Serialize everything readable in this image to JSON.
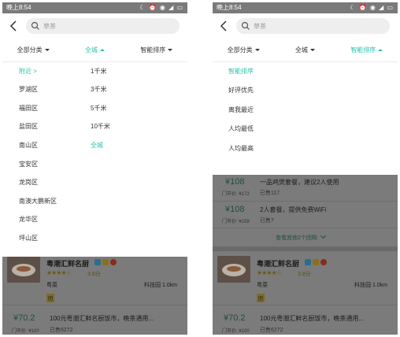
{
  "left": {
    "status": {
      "time": "晚上8:54",
      "icons": "☾ ⏰ ◉ ◢ ▭"
    },
    "search": {
      "placeholder": "草茶"
    },
    "filters": [
      "全部分类",
      "全城",
      "智能排序"
    ],
    "districts": [
      "附近",
      "罗湖区",
      "福田区",
      "盐田区",
      "南山区",
      "宝安区",
      "龙岗区",
      "南澳大鹏新区",
      "龙华区",
      "坪山区"
    ],
    "distances": [
      "1千米",
      "3千米",
      "5千米",
      "10千米",
      "全城"
    ],
    "restaurant": {
      "name": "粤潮汇鲜名厨",
      "rating": "3.8分",
      "category": "粤菜",
      "location": "科技园 1.0km",
      "tag": "团"
    },
    "deal": {
      "price": "¥70.2",
      "title": "100元粤潮汇鲜名厨饭市，晚茶通用...",
      "original": "门市价: ¥100",
      "sold": "已售6272"
    }
  },
  "right": {
    "status": {
      "time": "晚上8:54",
      "icons": "☾ ⏰ ◉ ◢ ▭"
    },
    "search": {
      "placeholder": "草茶"
    },
    "filters": [
      "全部分类",
      "全城",
      "智能排序"
    ],
    "sort_options": [
      "智能排序",
      "好评优先",
      "离我最近",
      "人均最低",
      "人均最高"
    ],
    "deals_top": [
      {
        "price": "¥108",
        "title": "一品鸡煲套餐，建议2人使用",
        "original": "门市价: ¥172",
        "sold": "已售117"
      },
      {
        "price": "¥108",
        "title": "2人套餐，提供免费WiFi",
        "original": "门市价: ¥158",
        "sold": "已售7"
      }
    ],
    "more_link": "查看其他2个团购",
    "restaurant": {
      "name": "粤潮汇鲜名厨",
      "rating": "3.8分",
      "category": "粤菜",
      "location": "科技园 1.0km",
      "tag": "团"
    },
    "deal": {
      "price": "¥70.2",
      "title": "100元粤潮汇鲜名厨饭市，晚茶通用...",
      "original": "门市价: ¥100",
      "sold": "已售6272"
    }
  },
  "colors": {
    "accent": "#2cc3ad",
    "overlay": "#7b7b7b",
    "badge_blue": "#2a6e8c",
    "badge_gold": "#8a6f1e",
    "badge_red": "#8a2a1e"
  }
}
